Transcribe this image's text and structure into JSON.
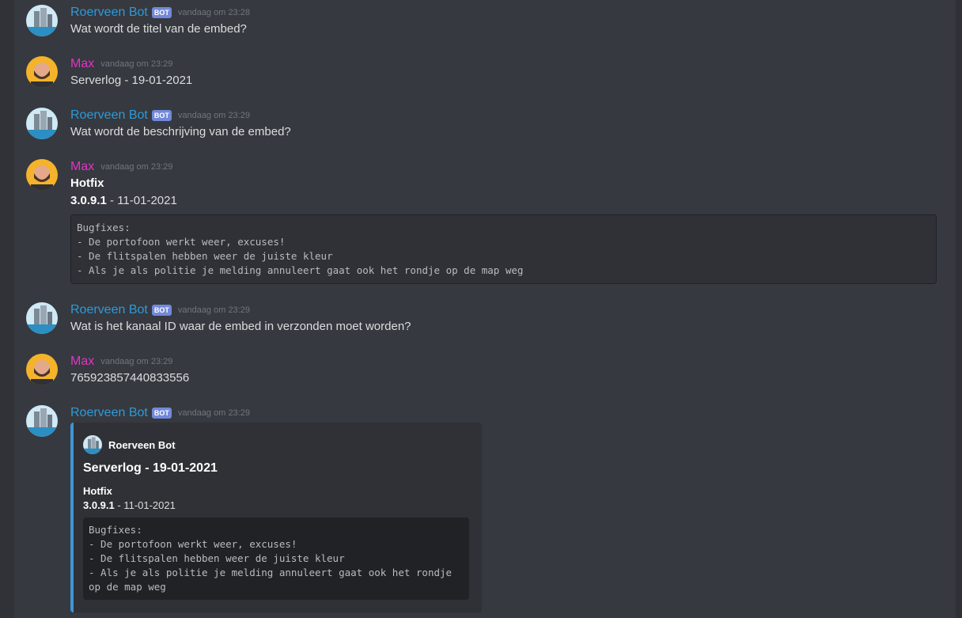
{
  "messages": [
    {
      "author": "Roerveen Bot",
      "bot_badge": "BOT",
      "time": "vandaag om 23:28",
      "text": "Wat wordt de titel van de embed?"
    },
    {
      "author": "Max",
      "time": "vandaag om 23:29",
      "text": "Serverlog - 19-01-2021"
    },
    {
      "author": "Roerveen Bot",
      "bot_badge": "BOT",
      "time": "vandaag om 23:29",
      "text": "Wat wordt de beschrijving van de embed?"
    },
    {
      "author": "Max",
      "time": "vandaag om 23:29",
      "title": "Hotfix",
      "version": "3.0.9.1",
      "date_suffix": " - 11-01-2021",
      "code": "Bugfixes:\n- De portofoon werkt weer, excuses!\n- De flitspalen hebben weer de juiste kleur\n- Als je als politie je melding annuleert gaat ook het rondje op de map weg"
    },
    {
      "author": "Roerveen Bot",
      "bot_badge": "BOT",
      "time": "vandaag om 23:29",
      "text": "Wat is het kanaal ID waar de embed in verzonden moet worden?"
    },
    {
      "author": "Max",
      "time": "vandaag om 23:29",
      "text": "765923857440833556"
    },
    {
      "author": "Roerveen Bot",
      "bot_badge": "BOT",
      "time": "vandaag om 23:29"
    }
  ],
  "embed": {
    "author": "Roerveen Bot",
    "title": "Serverlog - 19-01-2021",
    "desc_title": "Hotfix",
    "version": "3.0.9.1",
    "date_suffix": " - 11-01-2021",
    "code": "Bugfixes:\n- De portofoon werkt weer, excuses!\n- De flitspalen hebben weer de juiste kleur\n- Als je als politie je melding annuleert gaat ook het rondje op de map weg",
    "accent_color": "#3e95d6"
  },
  "colors": {
    "background": "#36393f",
    "bot_name": "#2e9ad8",
    "max_name": "#e233c6",
    "badge": "#7289da"
  },
  "icons": {
    "bot_avatar": "building-avatar-icon",
    "max_avatar": "bearded-man-avatar-icon"
  }
}
